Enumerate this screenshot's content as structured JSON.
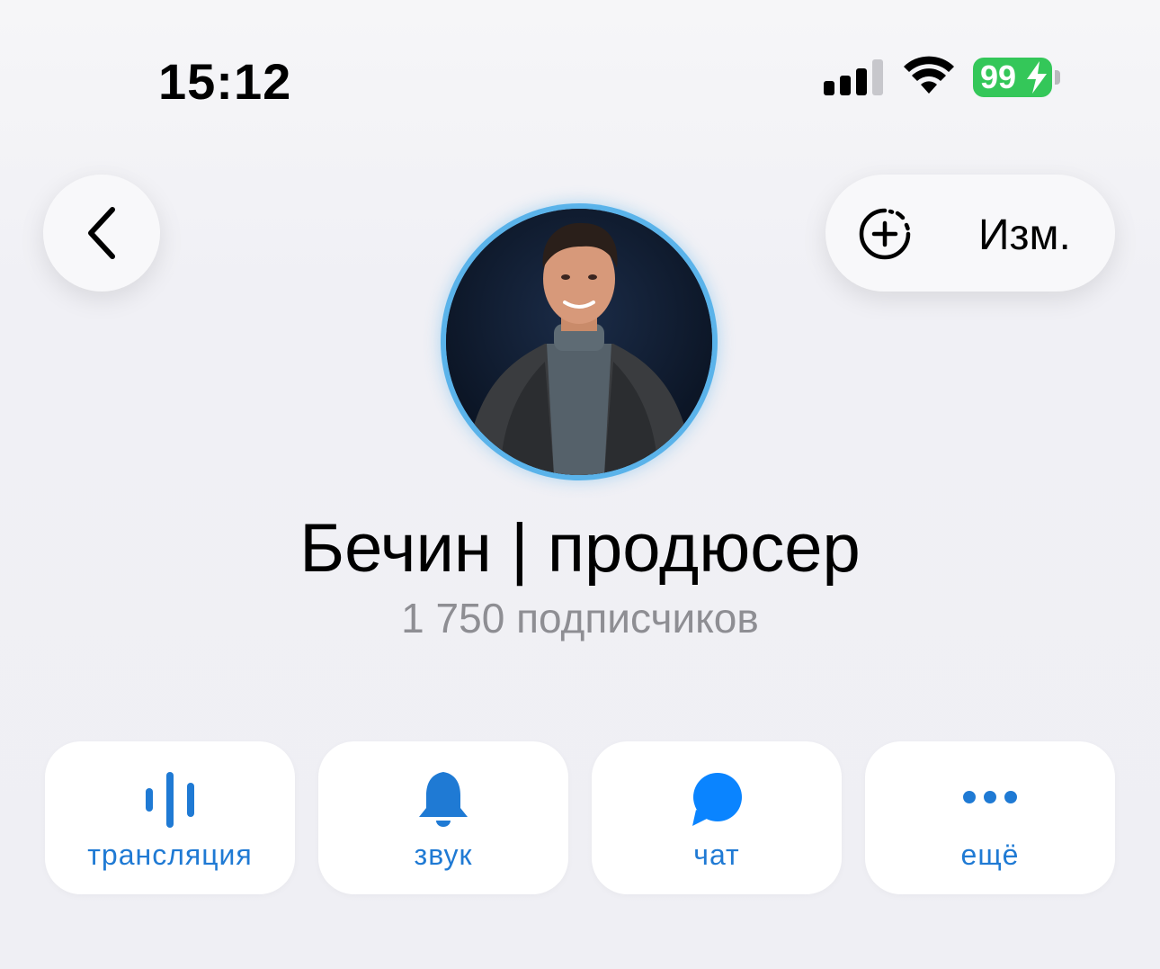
{
  "status_bar": {
    "time": "15:12",
    "battery_percent": "99",
    "battery_charging": true,
    "icons": [
      "cellular-signal-icon",
      "wifi-icon",
      "battery-icon"
    ]
  },
  "header": {
    "back_icon": "chevron-left-icon",
    "add_story_icon": "add-story-icon",
    "edit_label": "Изм."
  },
  "profile": {
    "title": "Бечин | продюсер",
    "subscribers": "1 750 подписчиков",
    "ring_color": "#5ab3ea"
  },
  "actions": [
    {
      "label": "трансляция",
      "icon": "live-stream-icon"
    },
    {
      "label": "звук",
      "icon": "bell-icon"
    },
    {
      "label": "чат",
      "icon": "chat-bubble-icon"
    },
    {
      "label": "ещё",
      "icon": "more-dots-icon"
    }
  ],
  "colors": {
    "accent": "#1f7ad4",
    "icon_accent": "#0a84ff",
    "battery": "#34c759",
    "secondary_text": "#8e8e93"
  }
}
